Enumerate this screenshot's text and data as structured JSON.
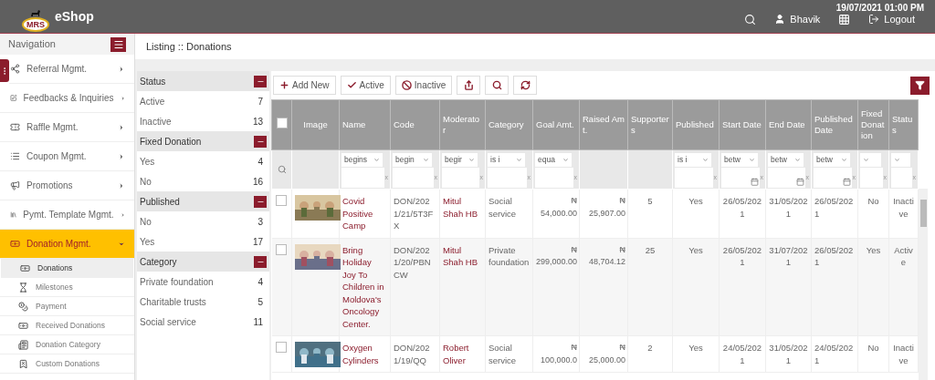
{
  "header": {
    "logo_text": "MRS",
    "brand": "eShop",
    "datetime": "19/07/2021 01:00 PM",
    "user": "Bhavik",
    "logout": "Logout"
  },
  "sidebar": {
    "title": "Navigation",
    "items": [
      {
        "label": "Referral Mgmt.",
        "expanded": false,
        "selected": false
      },
      {
        "label": "Feedbacks & Inquiries",
        "expanded": false,
        "selected": false
      },
      {
        "label": "Raffle Mgmt.",
        "expanded": false,
        "selected": false
      },
      {
        "label": "Coupon Mgmt.",
        "expanded": false,
        "selected": false
      },
      {
        "label": "Promotions",
        "expanded": false,
        "selected": false
      },
      {
        "label": "Pymt. Template Mgmt.",
        "expanded": false,
        "selected": false
      },
      {
        "label": "Donation Mgmt.",
        "expanded": true,
        "selected": true,
        "children": [
          {
            "label": "Donations",
            "selected": true
          },
          {
            "label": "Milestones",
            "selected": false
          },
          {
            "label": "Payment",
            "selected": false
          },
          {
            "label": "Received Donations",
            "selected": false
          },
          {
            "label": "Donation Category",
            "selected": false
          },
          {
            "label": "Custom Donations",
            "selected": false
          }
        ]
      }
    ]
  },
  "breadcrumb": "Listing :: Donations",
  "facets": [
    {
      "title": "Status",
      "options": [
        {
          "label": "Active",
          "count": "7"
        },
        {
          "label": "Inactive",
          "count": "13"
        }
      ]
    },
    {
      "title": "Fixed Donation",
      "options": [
        {
          "label": "Yes",
          "count": "4"
        },
        {
          "label": "No",
          "count": "16"
        }
      ]
    },
    {
      "title": "Published",
      "options": [
        {
          "label": "No",
          "count": "3"
        },
        {
          "label": "Yes",
          "count": "17"
        }
      ]
    },
    {
      "title": "Category",
      "options": [
        {
          "label": "Private foundation",
          "count": "4"
        },
        {
          "label": "Charitable trusts",
          "count": "5"
        },
        {
          "label": "Social service",
          "count": "11"
        }
      ]
    }
  ],
  "toolbar": [
    {
      "kind": "add",
      "label": "Add New"
    },
    {
      "kind": "active",
      "label": "Active"
    },
    {
      "kind": "inactive",
      "label": "Inactive"
    },
    {
      "kind": "export"
    },
    {
      "kind": "search"
    },
    {
      "kind": "refresh"
    }
  ],
  "table": {
    "all_selected": false,
    "columns": [
      {
        "label": "Image",
        "filter": {
          "kind": "none"
        }
      },
      {
        "label": "Name",
        "filter": {
          "kind": "select",
          "value": "begins",
          "clear": "x"
        }
      },
      {
        "label": "Code",
        "filter": {
          "kind": "select",
          "value": "begin",
          "clear": "x"
        }
      },
      {
        "label": "Moderator",
        "filter": {
          "kind": "select",
          "value": "begir",
          "clear": "x"
        }
      },
      {
        "label": "Category",
        "filter": {
          "kind": "select",
          "value": "is i",
          "clear": "x"
        }
      },
      {
        "label": "Goal Amt.",
        "filter": {
          "kind": "select",
          "value": "equa",
          "clear": "x"
        }
      },
      {
        "label": "Raised Amt.",
        "filter": {
          "kind": "none"
        }
      },
      {
        "label": "Supporters",
        "filter": {
          "kind": "none"
        }
      },
      {
        "label": "Published",
        "filter": {
          "kind": "select",
          "value": "is i",
          "clear": "x"
        }
      },
      {
        "label": "Start Date",
        "filter": {
          "kind": "date",
          "value": "betw",
          "clear": "x"
        }
      },
      {
        "label": "End Date",
        "filter": {
          "kind": "date",
          "value": "betw",
          "clear": "x"
        }
      },
      {
        "label": "Published Date",
        "filter": {
          "kind": "date",
          "value": "betw",
          "clear": "x"
        }
      },
      {
        "label": "Fixed Donation",
        "filter": {
          "kind": "select",
          "clear": "x"
        }
      },
      {
        "label": "Status",
        "filter": {
          "kind": "select",
          "clear": "x"
        }
      }
    ],
    "rows": [
      {
        "selected": false,
        "name": "Covid Positive Camp",
        "code": "DON/2021/21/5T3FX",
        "moderator": "Mitul Shah HB",
        "category": "Social service",
        "goal_currency": "₦",
        "goal": "54,000.00",
        "raised_currency": "₦",
        "raised": "25,907.00",
        "supporters": "5",
        "published": "Yes",
        "start": "26/05/2021",
        "end": "31/05/2021",
        "published_date": "26/05/2021",
        "fixed": "No",
        "status": "Inactive"
      },
      {
        "selected": false,
        "name": "Bring Holiday Joy To Children in Moldova's Oncology Center.",
        "code": "DON/2021/20/PBNCW",
        "moderator": "Mitul Shah HB",
        "category": "Private foundation",
        "goal_currency": "₦",
        "goal": "299,000.00",
        "raised_currency": "₦",
        "raised": "48,704.12",
        "supporters": "25",
        "published": "Yes",
        "start": "26/05/2021",
        "end": "31/07/2021",
        "published_date": "26/05/2021",
        "fixed": "Yes",
        "status": "Active"
      },
      {
        "selected": false,
        "name": "Oxygen Cylinders",
        "code": "DON/2021/19/QQ",
        "moderator": "Robert Oliver",
        "category": "Social service",
        "goal_currency": "₦",
        "goal": "100,000.0",
        "raised_currency": "₦",
        "raised": "25,000.00",
        "supporters": "2",
        "published": "Yes",
        "start": "24/05/2021",
        "end": "31/05/2021",
        "published_date": "24/05/2021",
        "fixed": "No",
        "status": "Inactive"
      }
    ]
  }
}
